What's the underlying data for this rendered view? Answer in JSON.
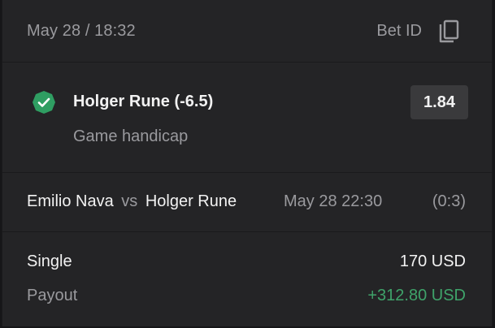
{
  "header": {
    "date_time": "May 28 / 18:32",
    "bet_id_label": "Bet ID",
    "copy_icon": "copy-icon"
  },
  "selection": {
    "status_icon": "check-shield-icon",
    "status_color": "#2f9e62",
    "title": "Holger Rune (-6.5)",
    "market": "Game handicap",
    "odds": "1.84"
  },
  "match": {
    "player1": "Emilio Nava",
    "vs": "vs",
    "player2": "Holger Rune",
    "datetime": "May 28 22:30",
    "score": "(0:3)"
  },
  "summary": {
    "bet_type": "Single",
    "stake": "170 USD",
    "payout_label": "Payout",
    "payout_value": "+312.80 USD",
    "payout_color": "#3fa36a"
  }
}
